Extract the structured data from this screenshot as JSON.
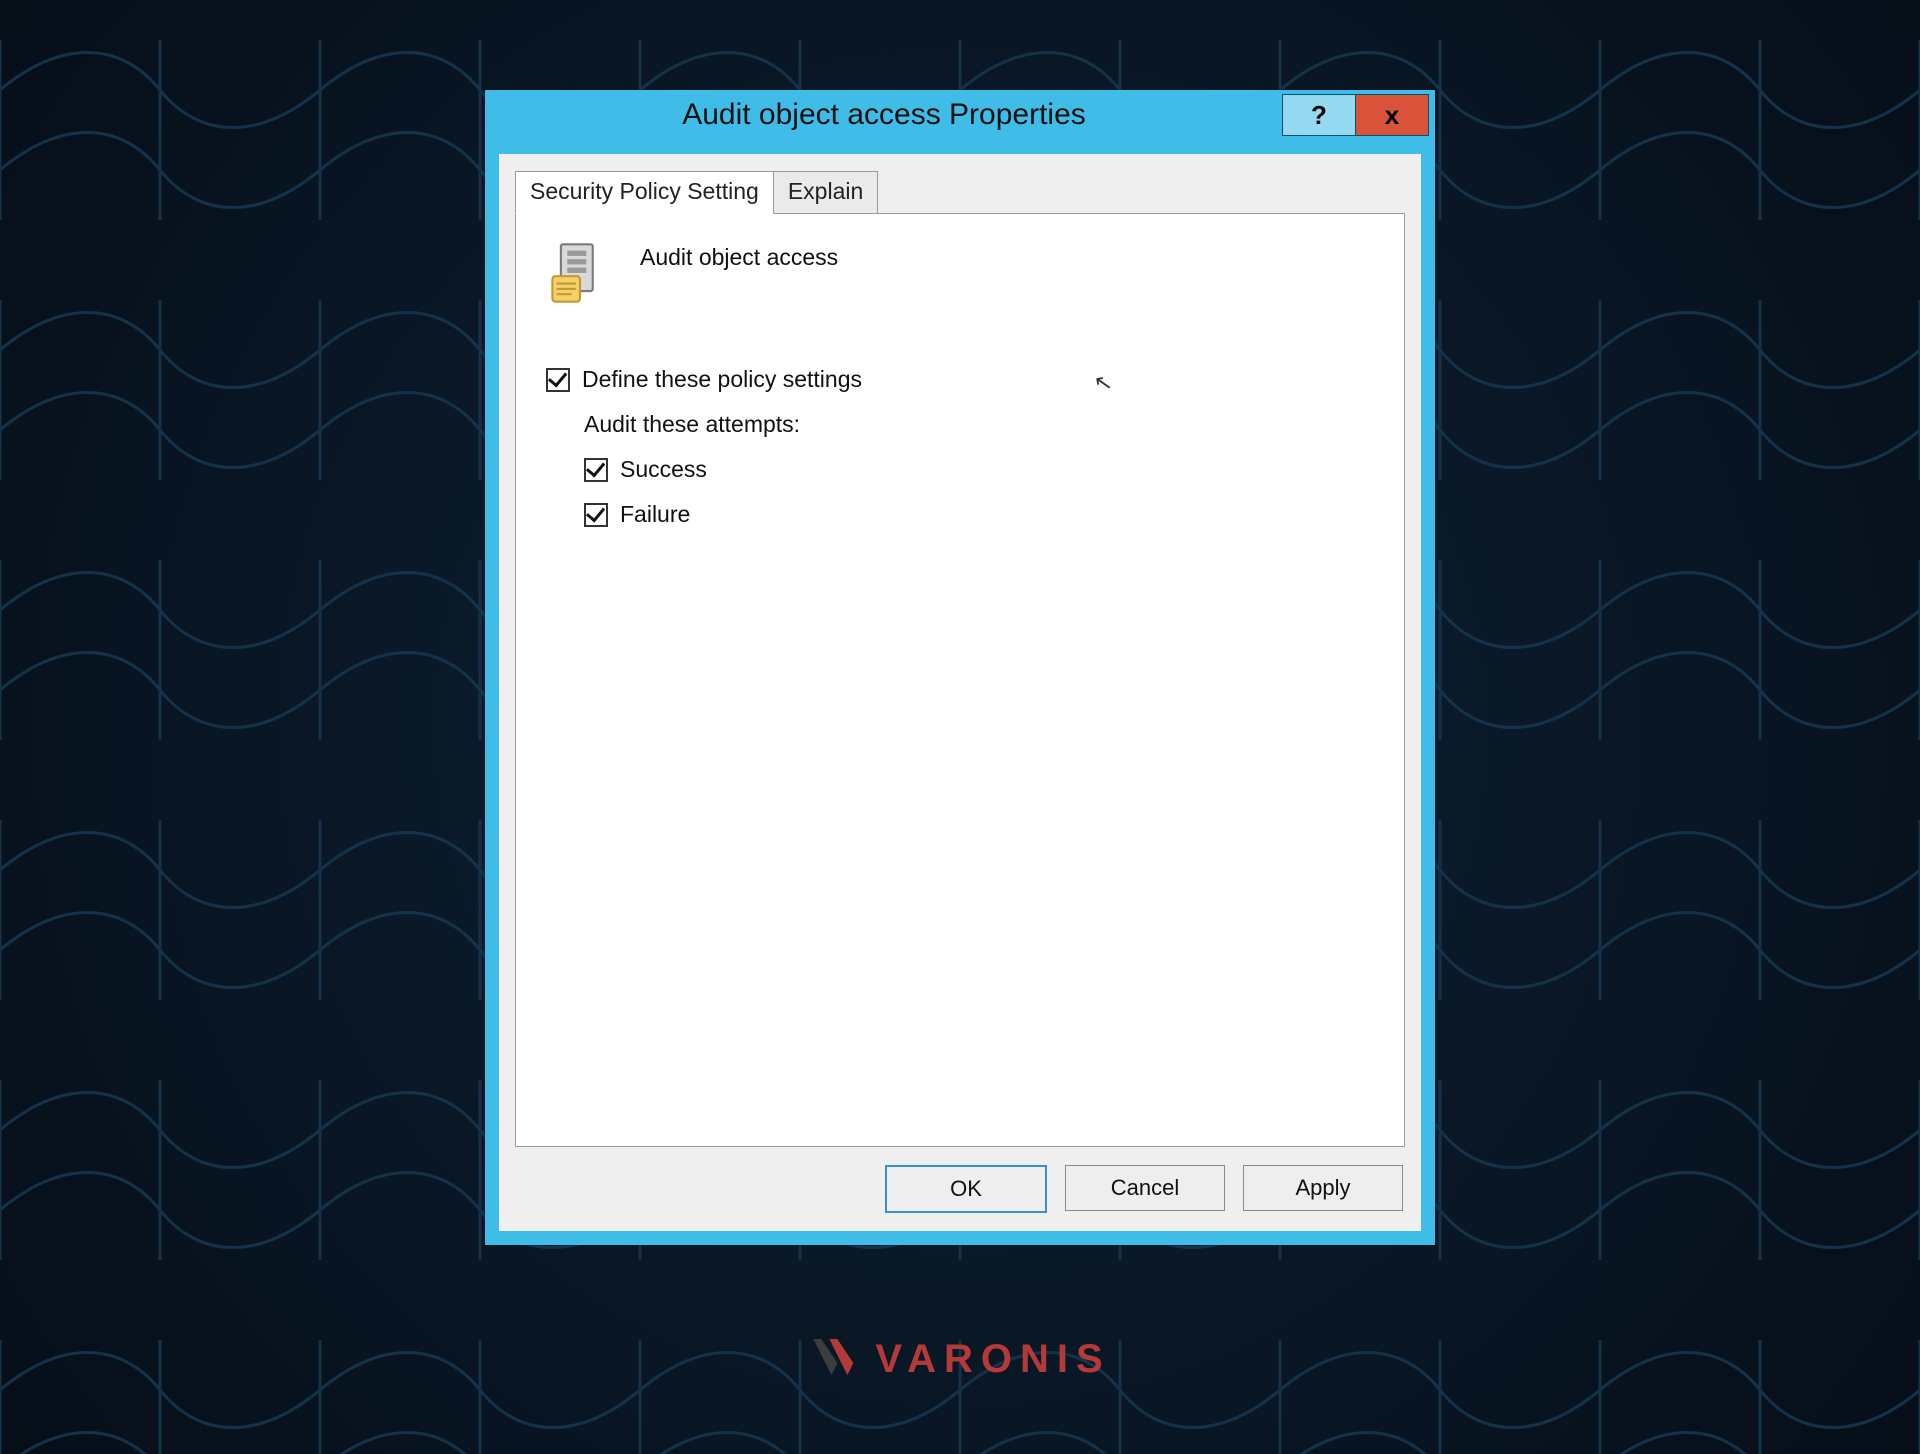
{
  "dialog": {
    "title": "Audit object access Properties",
    "help_glyph": "?",
    "close_glyph": "x",
    "tabs": {
      "active": "Security Policy Setting",
      "inactive": "Explain"
    },
    "policy_name": "Audit object access",
    "define_label": "Define these policy settings",
    "define_checked": true,
    "attempts_label": "Audit these attempts:",
    "success_label": "Success",
    "success_checked": true,
    "failure_label": "Failure",
    "failure_checked": true,
    "buttons": {
      "ok": "OK",
      "cancel": "Cancel",
      "apply": "Apply"
    }
  },
  "brand": {
    "text": "VARONIS"
  }
}
